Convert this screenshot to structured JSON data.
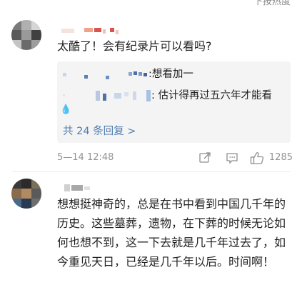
{
  "top_link": "下按热度",
  "comments": [
    {
      "text": "太酷了！会有纪录片可以看吗?",
      "replies": [
        {
          "text": ":想看加一"
        },
        {
          "text": ": 估计得再过五六年才能看"
        }
      ],
      "reply_total": "共 24 条回复 >",
      "time": "5—14 12:48",
      "likes": "1285"
    },
    {
      "text": "想想挺神奇的，总是在书中看到中国几千年的历史。这些墓葬，遗物，在下葬的时候无论如何也想不到，这一下去就是几千年过去了，如今重见天日，已经是几千年以后。时间啊！"
    }
  ],
  "icons": {
    "share": "share-icon",
    "comment": "comment-icon",
    "like": "thumbs-up-icon"
  },
  "colors": {
    "link": "#507daf",
    "meta": "#939393",
    "text": "#222222",
    "reply_bg": "#f4f4f4"
  }
}
